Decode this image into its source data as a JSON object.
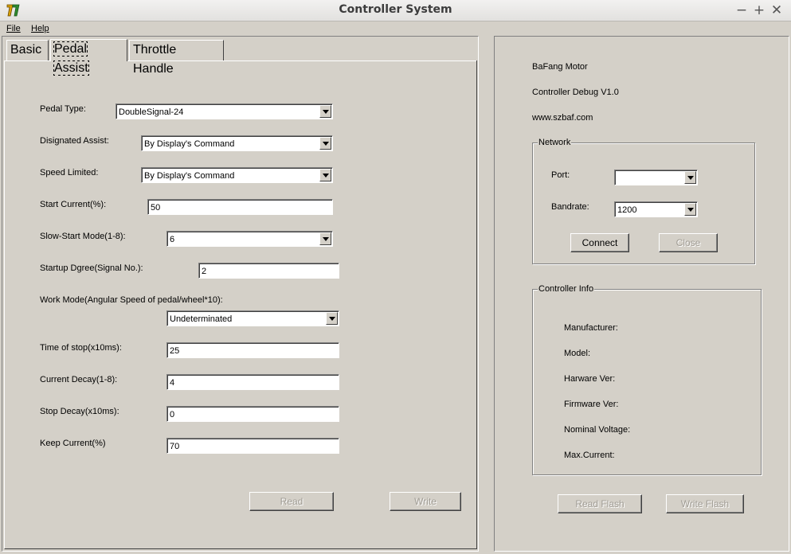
{
  "window": {
    "title": "Controller System"
  },
  "menu": [
    "File",
    "Help"
  ],
  "tabs": [
    "Basic",
    "Pedal Assist",
    "Throttle Handle"
  ],
  "active_tab": "Pedal Assist",
  "form": {
    "pedal_type": {
      "label": "Pedal Type:",
      "value": "DoubleSignal-24"
    },
    "designated_assist": {
      "label": "Disignated Assist:",
      "value": "By Display's Command"
    },
    "speed_limited": {
      "label": "Speed Limited:",
      "value": "By Display's Command"
    },
    "start_current": {
      "label": "Start Current(%):",
      "value": "50"
    },
    "slow_start_mode": {
      "label": "Slow-Start Mode(1-8):",
      "value": "6"
    },
    "startup_degree": {
      "label": "Startup Dgree(Signal No.):",
      "value": "2"
    },
    "work_mode": {
      "label": "Work Mode(Angular Speed of pedal/wheel*10):",
      "value": "Undeterminated"
    },
    "time_of_stop": {
      "label": "Time of stop(x10ms):",
      "value": "25"
    },
    "current_decay": {
      "label": "Current Decay(1-8):",
      "value": "4"
    },
    "stop_decay": {
      "label": "Stop Decay(x10ms):",
      "value": "0"
    },
    "keep_current": {
      "label": "Keep Current(%)",
      "value": "70"
    },
    "read_label": "Read",
    "write_label": "Write"
  },
  "right": {
    "line1": "BaFang Motor",
    "line2": "Controller Debug V1.0",
    "line3": "www.szbaf.com",
    "network": {
      "title": "Network",
      "port_label": "Port:",
      "port_value": "",
      "bandrate_label": "Bandrate:",
      "bandrate_value": "1200",
      "connect_label": "Connect",
      "close_label": "Close"
    },
    "info": {
      "title": "Controller Info",
      "manufacturer": "Manufacturer:",
      "model": "Model:",
      "hardware": "Harware Ver:",
      "firmware": "Firmware Ver:",
      "voltage": "Nominal Voltage:",
      "max_current": "Max.Current:"
    },
    "read_flash_label": "Read Flash",
    "write_flash_label": "Write Flash"
  },
  "colors": {
    "face": "#d4d0c8",
    "shadow": "#808080",
    "highlight": "#ffffff",
    "disabled_text": "#a09c94"
  }
}
